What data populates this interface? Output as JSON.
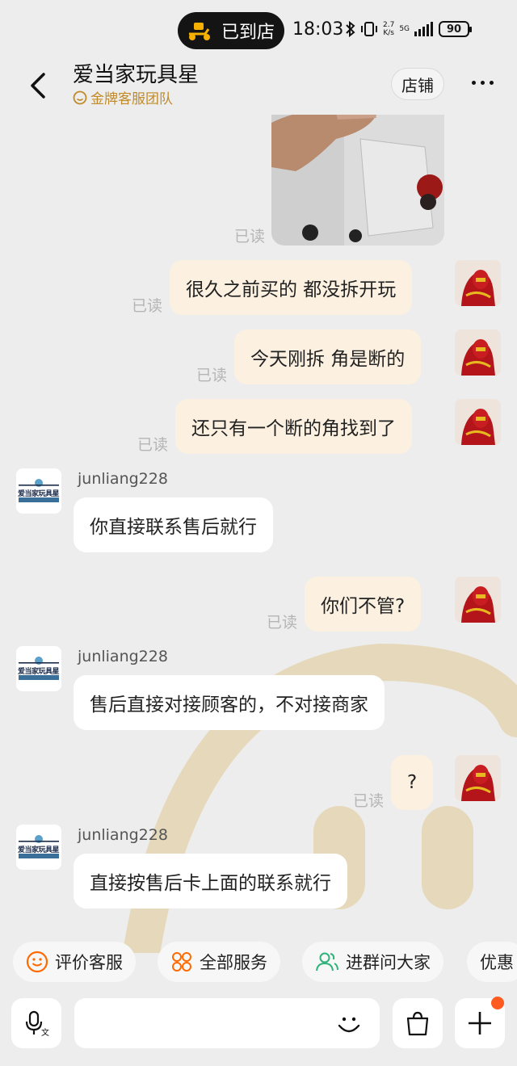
{
  "status_bar": {
    "pill_text": "已到店",
    "time": "18:03",
    "net_speed_top": "2.7",
    "net_speed_bottom": "K/s",
    "network": "5G",
    "battery": "90"
  },
  "header": {
    "title": "爱当家玩具星",
    "subtitle": "金牌客服团队",
    "shop_button": "店铺"
  },
  "shop_logo_text": "爱当家玩具星",
  "messages": [
    {
      "from": "me",
      "type": "image",
      "read": "已读"
    },
    {
      "from": "me",
      "text": "很久之前买的 都没拆开玩",
      "read": "已读"
    },
    {
      "from": "me",
      "text": "今天刚拆 角是断的",
      "read": "已读"
    },
    {
      "from": "me",
      "text": "还只有一个断的角找到了",
      "read": "已读"
    },
    {
      "from": "shop",
      "sender": "junliang228",
      "text": "你直接联系售后就行"
    },
    {
      "from": "me",
      "text": "你们不管?",
      "read": "已读"
    },
    {
      "from": "shop",
      "sender": "junliang228",
      "text": "售后直接对接顾客的，不对接商家"
    },
    {
      "from": "me",
      "text": "?",
      "read": "已读"
    },
    {
      "from": "shop",
      "sender": "junliang228",
      "text": "直接按售后卡上面的联系就行"
    }
  ],
  "quick_actions": [
    "评价客服",
    "全部服务",
    "进群问大家",
    "优惠"
  ],
  "colors": {
    "my_bubble": "#fcf1e0",
    "their_bubble": "#ffffff",
    "background": "#ededed",
    "accent_orange": "#ff6a00",
    "accent_green": "#2fb37a",
    "gold": "#c08a28"
  }
}
